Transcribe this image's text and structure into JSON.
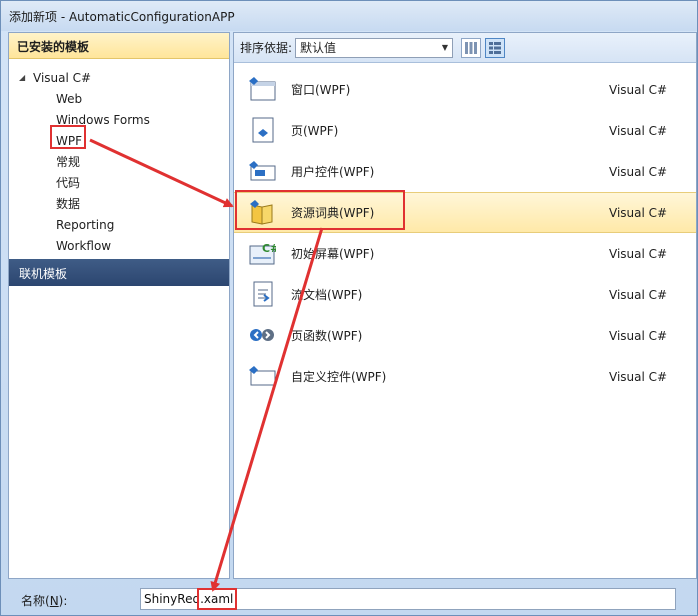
{
  "window": {
    "title": "添加新项 - AutomaticConfigurationAPP"
  },
  "left_panel": {
    "header": "已安装的模板",
    "root": "Visual C#",
    "items": [
      "Web",
      "Windows Forms",
      "WPF",
      "常规",
      "代码",
      "数据",
      "Reporting",
      "Workflow"
    ],
    "online_header": "联机模板"
  },
  "toolbar": {
    "sort_label": "排序依据:",
    "sort_value": "默认值"
  },
  "templates": [
    {
      "name": "窗口(WPF)",
      "type": "Visual C#",
      "icon": "wpf-window-icon"
    },
    {
      "name": "页(WPF)",
      "type": "Visual C#",
      "icon": "wpf-page-icon"
    },
    {
      "name": "用户控件(WPF)",
      "type": "Visual C#",
      "icon": "user-control-icon"
    },
    {
      "name": "资源词典(WPF)",
      "type": "Visual C#",
      "icon": "resource-dictionary-icon",
      "selected": true
    },
    {
      "name": "初始屏幕(WPF)",
      "type": "Visual C#",
      "icon": "splash-screen-icon"
    },
    {
      "name": "流文档(WPF)",
      "type": "Visual C#",
      "icon": "flow-document-icon"
    },
    {
      "name": "页函数(WPF)",
      "type": "Visual C#",
      "icon": "page-function-icon"
    },
    {
      "name": "自定义控件(WPF)",
      "type": "Visual C#",
      "icon": "custom-control-icon"
    }
  ],
  "bottom": {
    "name_label_prefix": "名称(",
    "name_label_hotkey": "N",
    "name_label_suffix": "):",
    "name_value": "ShinyRed.xaml"
  },
  "colors": {
    "annotation": "#e03131",
    "selection": "#ffe9a8",
    "online_header": "#2c4670"
  }
}
